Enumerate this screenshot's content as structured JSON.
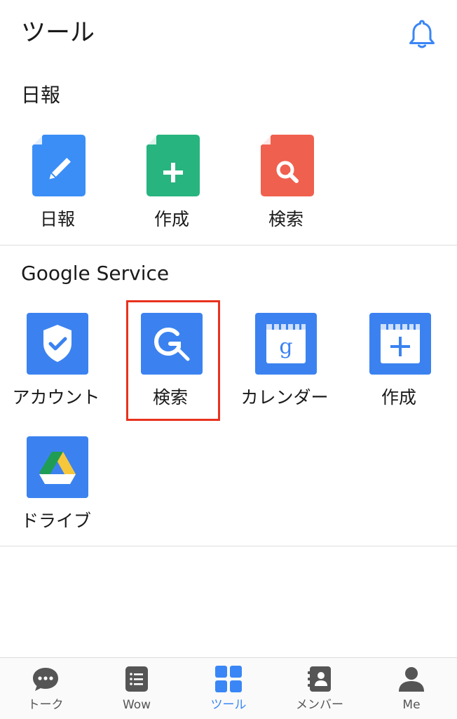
{
  "header": {
    "title": "ツール",
    "bell_icon": "bell-icon"
  },
  "sections": [
    {
      "title": "日報",
      "items": [
        {
          "label": "日報",
          "icon": "edit-document-icon",
          "color": "#3a8ef6"
        },
        {
          "label": "作成",
          "icon": "add-document-icon",
          "color": "#27b47f"
        },
        {
          "label": "検索",
          "icon": "search-document-icon",
          "color": "#f0604e"
        }
      ]
    },
    {
      "title": "Google Service",
      "items": [
        {
          "label": "アカウント",
          "icon": "shield-check-icon",
          "color": "#3b82f0"
        },
        {
          "label": "検索",
          "icon": "google-search-icon",
          "color": "#3b82f0"
        },
        {
          "label": "カレンダー",
          "icon": "google-calendar-icon",
          "color": "#3b82f0"
        },
        {
          "label": "作成",
          "icon": "calendar-add-icon",
          "color": "#3b82f0"
        },
        {
          "label": "ドライブ",
          "icon": "google-drive-icon",
          "color": "#3b82f0"
        }
      ]
    }
  ],
  "calendar_glyph": "g",
  "tabbar": {
    "active": "ツール",
    "tabs": [
      {
        "label": "トーク",
        "icon": "chat-bubble-icon"
      },
      {
        "label": "Wow",
        "icon": "list-note-icon"
      },
      {
        "label": "ツール",
        "icon": "grid-tools-icon"
      },
      {
        "label": "メンバー",
        "icon": "contacts-book-icon"
      },
      {
        "label": "Me",
        "icon": "person-icon"
      }
    ]
  },
  "colors": {
    "accent": "#3a86f6",
    "highlight_border": "#e8321e",
    "tab_inactive": "#555555"
  }
}
